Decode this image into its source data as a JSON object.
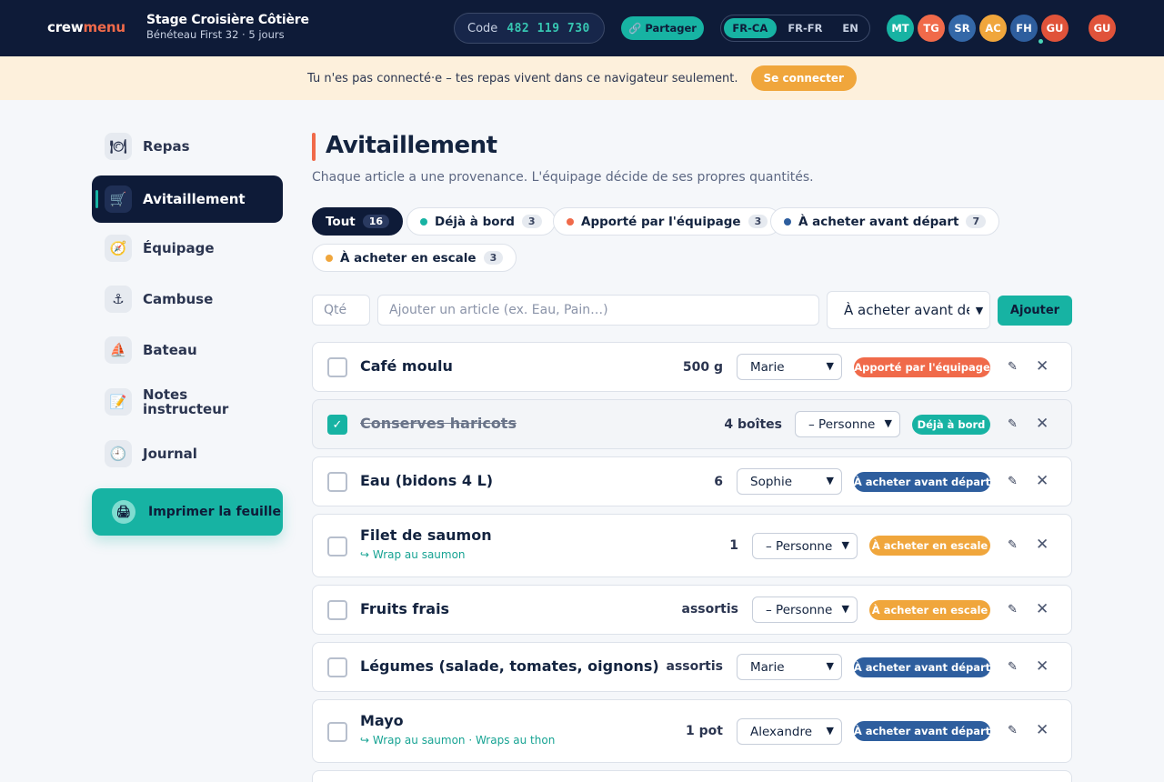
{
  "header": {
    "brand_part1": "crew",
    "brand_part2": "menu",
    "trip_title": "Stage Croisière Côtière",
    "trip_subtitle": "Bénéteau First 32 · 5 jours",
    "code_label": "Code",
    "code_value": "482 119 730",
    "share_label": "Partager",
    "languages": [
      "FR-CA",
      "FR-FR",
      "EN"
    ],
    "active_language": "FR-CA",
    "crew_avatars": [
      {
        "initials": "MT",
        "color": "#17b3a3"
      },
      {
        "initials": "TG",
        "color": "#f06a4a"
      },
      {
        "initials": "SR",
        "color": "#3468a8"
      },
      {
        "initials": "AC",
        "color": "#f0a63c"
      },
      {
        "initials": "FH",
        "color": "#2e5e9e"
      },
      {
        "initials": "GU",
        "color": "#e0533a"
      }
    ],
    "user_avatar": {
      "initials": "GU",
      "color": "#e0533a"
    }
  },
  "banner": {
    "message": "Tu n'es pas connecté·e – tes repas vivent dans ce navigateur seulement.",
    "connect_label": "Se connecter"
  },
  "sidebar": {
    "items": [
      {
        "label": "Repas",
        "icon": "plate-icon"
      },
      {
        "label": "Avitaillement",
        "icon": "cart-icon"
      },
      {
        "label": "Équipage",
        "icon": "compass-icon"
      },
      {
        "label": "Cambuse",
        "icon": "anchor-icon"
      },
      {
        "label": "Bateau",
        "icon": "sailboat-icon"
      },
      {
        "label": "Notes instructeur",
        "icon": "notes-icon"
      },
      {
        "label": "Journal",
        "icon": "clock-icon"
      }
    ],
    "active": "Avitaillement",
    "print_label": "Imprimer la feuille"
  },
  "main": {
    "title": "Avitaillement",
    "subtitle": "Chaque article a une provenance. L'équipage décide de ses propres quantités.",
    "filters": [
      {
        "label": "Tout",
        "count": "16",
        "active": true
      },
      {
        "label": "Déjà à bord",
        "count": "3",
        "color": "#17b3a3"
      },
      {
        "label": "Apporté par l'équipage",
        "count": "3",
        "color": "#f06a4a"
      },
      {
        "label": "À acheter avant départ",
        "count": "7",
        "color": "#2e5e9e"
      },
      {
        "label": "À acheter en escale",
        "count": "3",
        "color": "#f0a63c"
      }
    ],
    "add_form": {
      "qty_placeholder": "Qté",
      "item_placeholder": "Ajouter un article (ex. Eau, Pain…)",
      "source_selected": "À acheter avant départ",
      "add_label": "Ajouter"
    },
    "items": [
      {
        "name": "Café moulu",
        "qty": "500 g",
        "person": "Marie",
        "badge": "Apporté par l'équipage",
        "badge_color": "#f06a4a",
        "checked": false,
        "note": ""
      },
      {
        "name": "Conserves haricots",
        "qty": "4 boîtes",
        "person": "– Personne",
        "badge": "Déjà à bord",
        "badge_color": "#17b3a3",
        "checked": true,
        "note": ""
      },
      {
        "name": "Eau (bidons 4 L)",
        "qty": "6",
        "person": "Sophie",
        "badge": "À acheter avant départ",
        "badge_color": "#2e5e9e",
        "checked": false,
        "note": ""
      },
      {
        "name": "Filet de saumon",
        "qty": "1",
        "person": "– Personne",
        "badge": "À acheter en escale",
        "badge_color": "#f0a63c",
        "checked": false,
        "note": "↪ Wrap au saumon"
      },
      {
        "name": "Fruits frais",
        "qty": "assortis",
        "person": "– Personne",
        "badge": "À acheter en escale",
        "badge_color": "#f0a63c",
        "checked": false,
        "note": ""
      },
      {
        "name": "Légumes (salade, tomates, oignons)",
        "qty": "assortis",
        "person": "Marie",
        "badge": "À acheter avant départ",
        "badge_color": "#2e5e9e",
        "checked": false,
        "note": ""
      },
      {
        "name": "Mayo",
        "qty": "1 pot",
        "person": "Alexandre",
        "badge": "À acheter avant départ",
        "badge_color": "#2e5e9e",
        "checked": false,
        "note": "↪ Wrap au saumon · Wraps au thon"
      }
    ]
  }
}
